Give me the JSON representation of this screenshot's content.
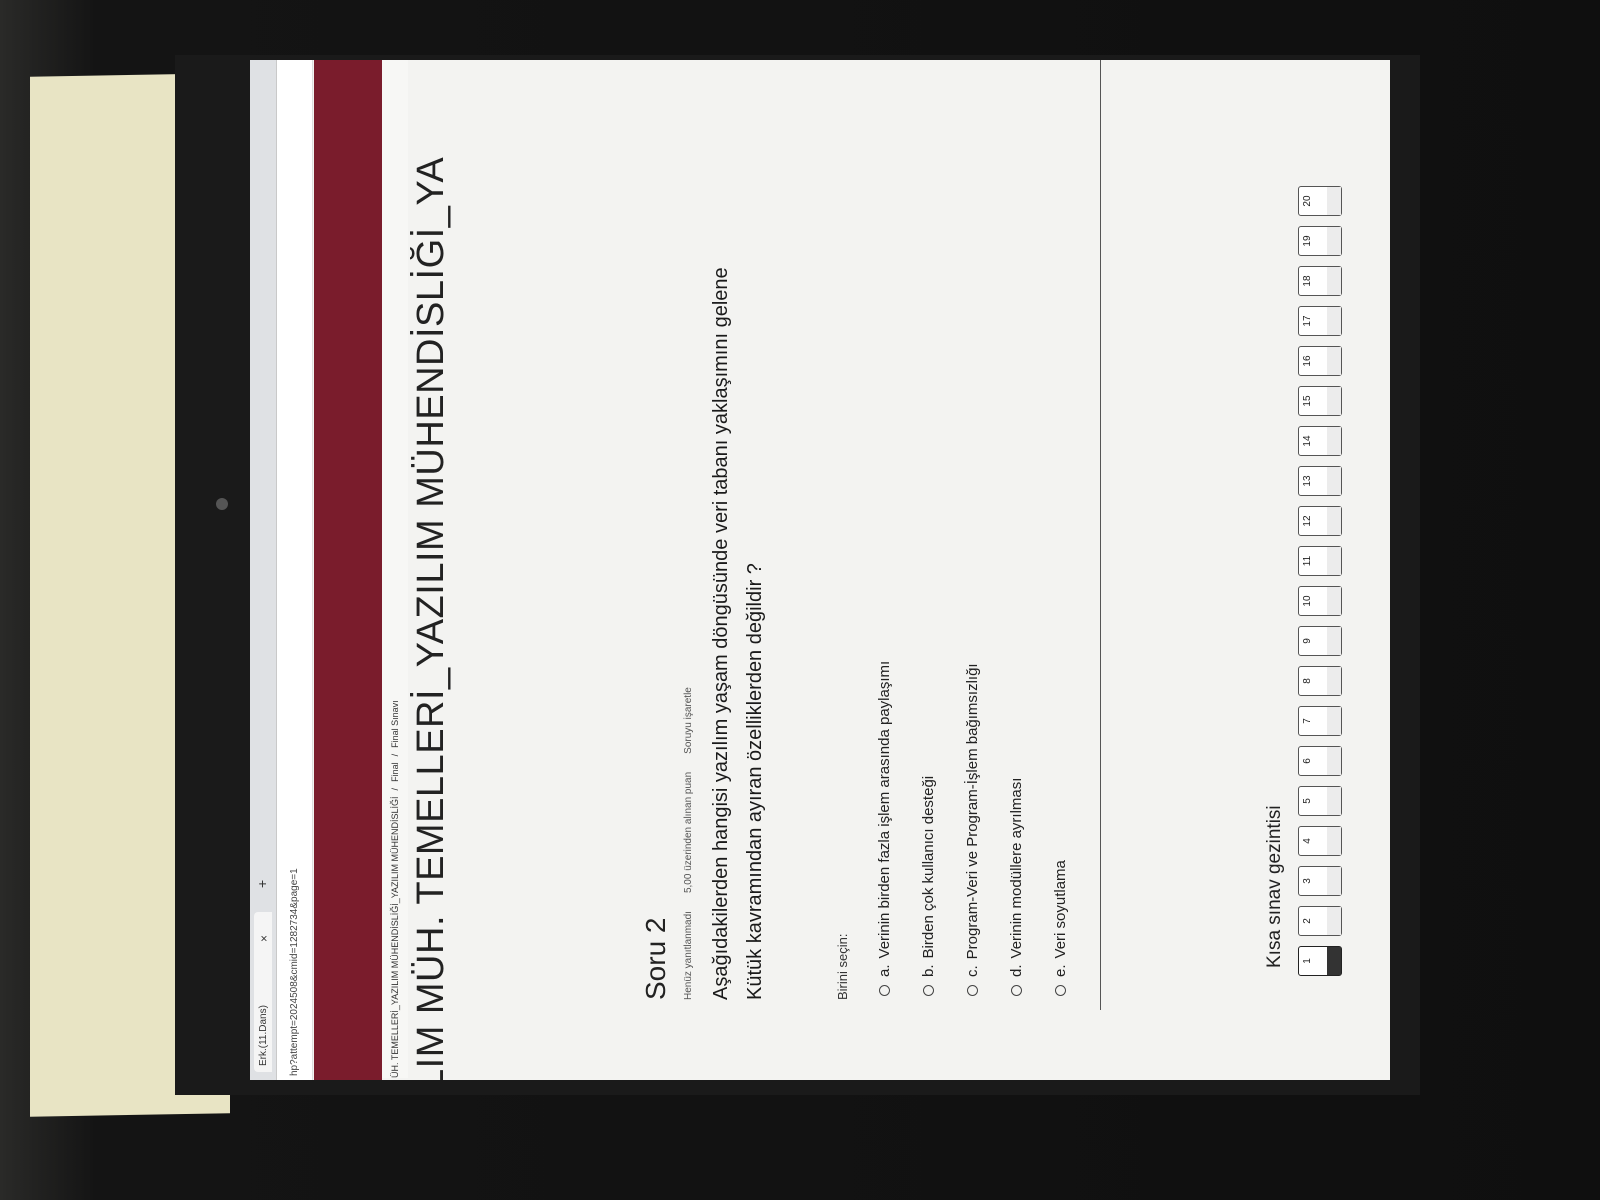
{
  "browser": {
    "tab_label": "Erk.(11.Dans)",
    "tab_close": "×",
    "new_tab": "+",
    "url": "hp?attempt=2024508&cmid=1282734&page=1"
  },
  "breadcrumb": {
    "course": "ÜH. TEMELLERİ_YAZILIM MÜHENDİSLİĞİ_YAZILIM MÜHENDİSLİĞİ",
    "sep1": "/",
    "section": "Final",
    "sep2": "/",
    "page": "Final Sınavı"
  },
  "page_heading": "LIM MÜH. TEMELLERİ_YAZILIM MÜHENDİSLİĞİ_YA",
  "question": {
    "title": "Soru 2",
    "status": "Henüz yanıtlanmadı",
    "points": "5,00 üzerinden alınan puan",
    "flag": "Soruyu işaretle",
    "text_line1": "Aşağıdakilerden hangisi yazılım yaşam döngüsünde veri tabanı yaklaşımını gelene",
    "text_line2": "Kütük kavramından ayıran özelliklerden değildir ?",
    "prompt": "Birini seçin:",
    "options": [
      {
        "letter": "a.",
        "text": "Verinin birden fazla işlem arasında paylaşımı"
      },
      {
        "letter": "b.",
        "text": "Birden çok kullanıcı desteği"
      },
      {
        "letter": "c.",
        "text": "Program-Veri ve Program-İşlem bağımsızlığı"
      },
      {
        "letter": "d.",
        "text": "Verinin modüllere ayrılması"
      },
      {
        "letter": "e.",
        "text": "Veri soyutlama"
      }
    ]
  },
  "navigation": {
    "title": "Kısa sınav gezintisi",
    "current": 1,
    "buttons": [
      "1",
      "2",
      "3",
      "4",
      "5",
      "6",
      "7",
      "8",
      "9",
      "10",
      "11",
      "12",
      "13",
      "14",
      "15",
      "16",
      "17",
      "18",
      "19",
      "20"
    ]
  },
  "colors": {
    "banner": "#7a1c2c",
    "background": "#f3f3f1"
  }
}
